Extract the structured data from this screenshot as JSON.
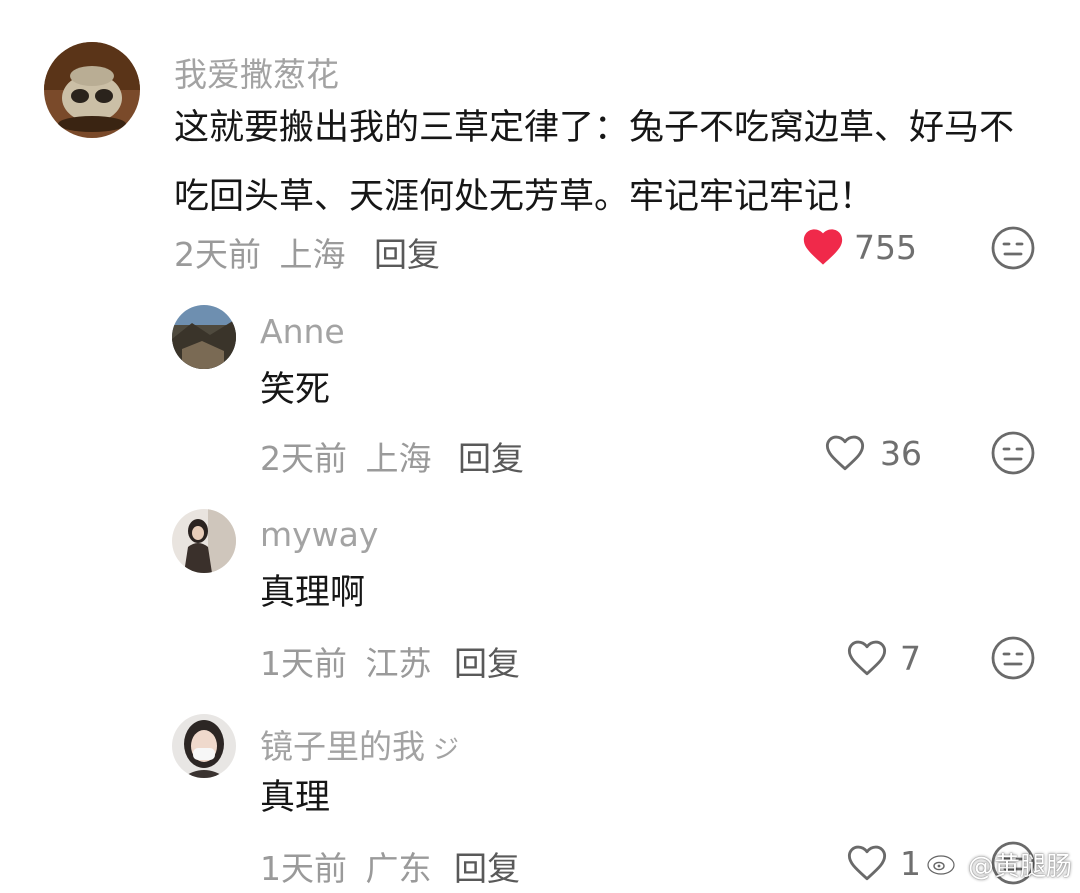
{
  "colors": {
    "username": "#a3a3a3",
    "meta": "#9a9a9a",
    "reply": "#595959",
    "text": "#161616",
    "like_active": "#f0294a",
    "icon_gray": "#6a6a6a"
  },
  "comments": [
    {
      "username": "我爱撒葱花",
      "content": "这就要搬出我的三草定律了：兔子不吃窝边草、好马不吃回头草、天涯何处无芳草。牢记牢记牢记！",
      "time": "2天前",
      "location": "上海",
      "reply_label": "回复",
      "likes": "755",
      "liked": true,
      "like_icon": "heart-filled-icon",
      "dislike_icon": "meh-face-icon"
    },
    {
      "username": "Anne",
      "content": "笑死",
      "time": "2天前",
      "location": "上海",
      "reply_label": "回复",
      "likes": "36",
      "liked": false,
      "like_icon": "heart-outline-icon",
      "dislike_icon": "meh-face-icon"
    },
    {
      "username": "myway",
      "content": "真理啊",
      "time": "1天前",
      "location": "江苏",
      "reply_label": "回复",
      "likes": "7",
      "liked": false,
      "like_icon": "heart-outline-icon",
      "dislike_icon": "meh-face-icon"
    },
    {
      "username": "镜子里的我",
      "username_suffix": "ジ",
      "content": "真理",
      "time": "1天前",
      "location": "广东",
      "reply_label": "回复",
      "likes": "1",
      "liked": false,
      "like_icon": "heart-outline-icon",
      "dislike_icon": "meh-face-icon"
    }
  ],
  "watermark": {
    "text": "@黄腿肠",
    "icon": "weibo-icon"
  }
}
